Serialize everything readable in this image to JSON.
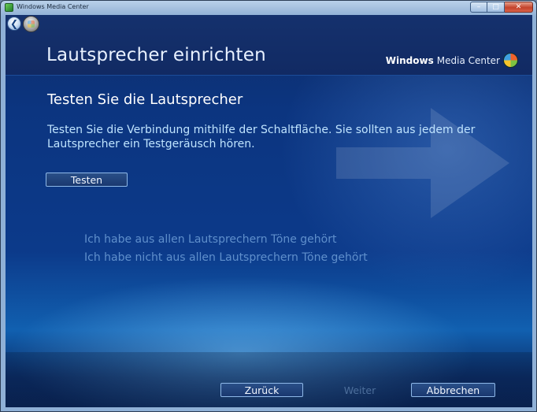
{
  "window": {
    "title": "Windows Media Center"
  },
  "header": {
    "title": "Lautsprecher einrichten",
    "brand_bold": "Windows",
    "brand_light": "Media Center"
  },
  "main": {
    "subtitle": "Testen Sie die Lautsprecher",
    "instructions": "Testen Sie die Verbindung mithilfe der Schaltfläche. Sie sollten aus jedem der Lautsprecher ein Testgeräusch hören.",
    "test_button": "Testen",
    "options": [
      "Ich habe aus allen Lautsprechern Töne gehört",
      "Ich habe nicht aus allen Lautsprechern Töne gehört"
    ]
  },
  "footer": {
    "back": "Zurück",
    "next": "Weiter",
    "cancel": "Abbrechen"
  },
  "colors": {
    "background": "#0c3580",
    "accent_text": "#bfe4ff",
    "option_text": "#5f8fcc"
  }
}
